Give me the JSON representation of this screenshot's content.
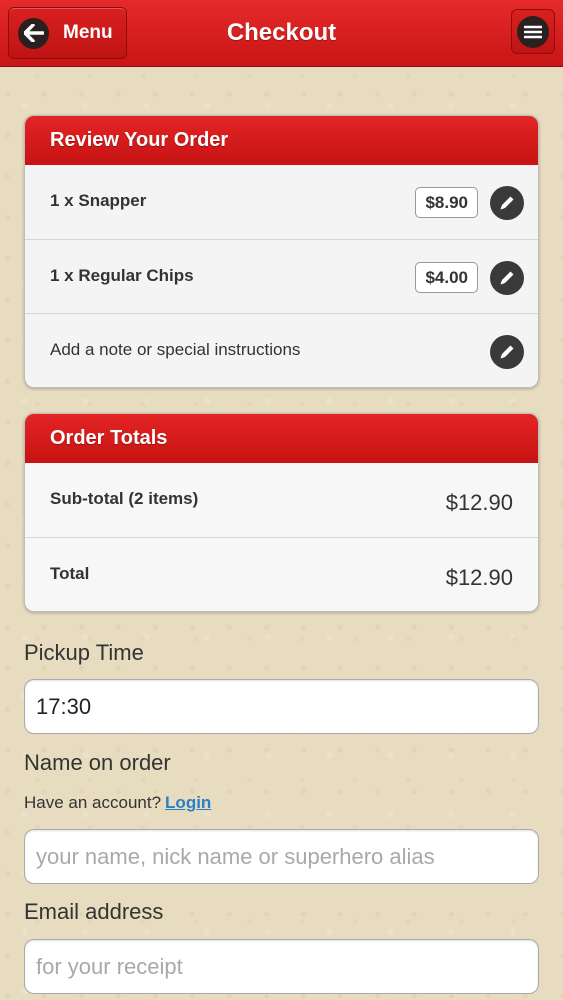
{
  "header": {
    "back_label": "Menu",
    "title": "Checkout"
  },
  "review": {
    "title": "Review Your Order",
    "items": [
      {
        "label": "1 x Snapper",
        "price": "$8.90"
      },
      {
        "label": "1 x Regular Chips",
        "price": "$4.00"
      }
    ],
    "note_label": "Add a note or special instructions"
  },
  "totals": {
    "title": "Order Totals",
    "subtotal_label": "Sub-total (2 items)",
    "subtotal_value": "$12.90",
    "total_label": "Total",
    "total_value": "$12.90"
  },
  "pickup": {
    "label": "Pickup Time",
    "value": "17:30"
  },
  "name": {
    "label": "Name on order",
    "account_prompt": "Have an account?",
    "login_link": "Login",
    "placeholder": "your name, nick name or superhero alias"
  },
  "email": {
    "label": "Email address",
    "placeholder": "for your receipt"
  },
  "colors": {
    "brand_red": "#d11a1a",
    "link_blue": "#2a7fc9"
  }
}
